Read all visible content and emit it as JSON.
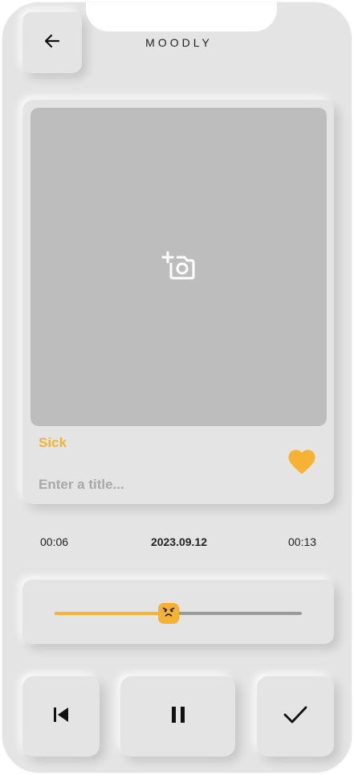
{
  "header": {
    "title": "MOODLY",
    "back_icon": "arrow-left-icon"
  },
  "entry": {
    "photo_icon": "add-photo-camera-icon",
    "mood": "Sick",
    "title_placeholder": "Enter a title...",
    "favorite_icon": "heart-icon",
    "accent_color": "#f7b233"
  },
  "player": {
    "elapsed": "00:06",
    "date": "2023.09.12",
    "duration": "00:13",
    "progress_fraction": 0.46,
    "thumb_icon": "sick-face-icon"
  },
  "controls": {
    "prev_icon": "skip-previous-icon",
    "pause_icon": "pause-icon",
    "done_icon": "check-icon"
  }
}
